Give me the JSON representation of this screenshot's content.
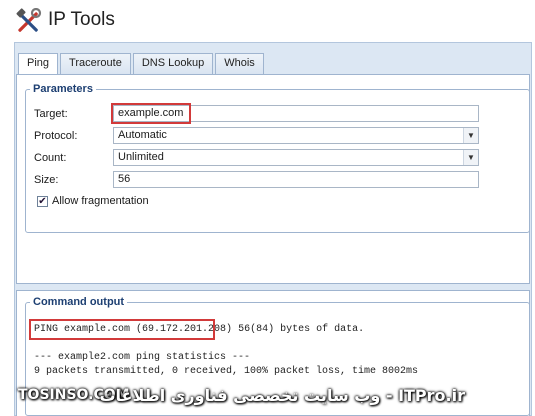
{
  "app": {
    "title": "IP Tools"
  },
  "tabs": [
    {
      "label": "Ping",
      "active": true
    },
    {
      "label": "Traceroute",
      "active": false
    },
    {
      "label": "DNS Lookup",
      "active": false
    },
    {
      "label": "Whois",
      "active": false
    }
  ],
  "parameters": {
    "legend": "Parameters",
    "target": {
      "label": "Target:",
      "value": "example.com"
    },
    "protocol": {
      "label": "Protocol:",
      "value": "Automatic"
    },
    "count": {
      "label": "Count:",
      "value": "Unlimited"
    },
    "size": {
      "label": "Size:",
      "value": "56"
    },
    "fragmentation": {
      "label": "Allow fragmentation",
      "checked": true
    }
  },
  "output": {
    "legend": "Command output",
    "line1_highlighted": "PING example.com (69.172.201.208)",
    "line1_rest": "56(84) bytes of data.",
    "line2": "--- example2.com ping statistics ---",
    "line3": "9 packets transmitted, 0 received, 100% packet loss, time 8002ms"
  },
  "watermark": {
    "left": "TOSINSO.COM",
    "right": "ITPro.ir - وب سایت تخصصی فناوری اطلاعات"
  },
  "colors": {
    "highlight": "#d23a3a",
    "legend": "#1d3f72",
    "panel": "#dce7f3"
  },
  "icons": {
    "app": "wrench-hammer-icon",
    "dropdown": "chevron-down-icon",
    "check": "checkmark-icon"
  }
}
